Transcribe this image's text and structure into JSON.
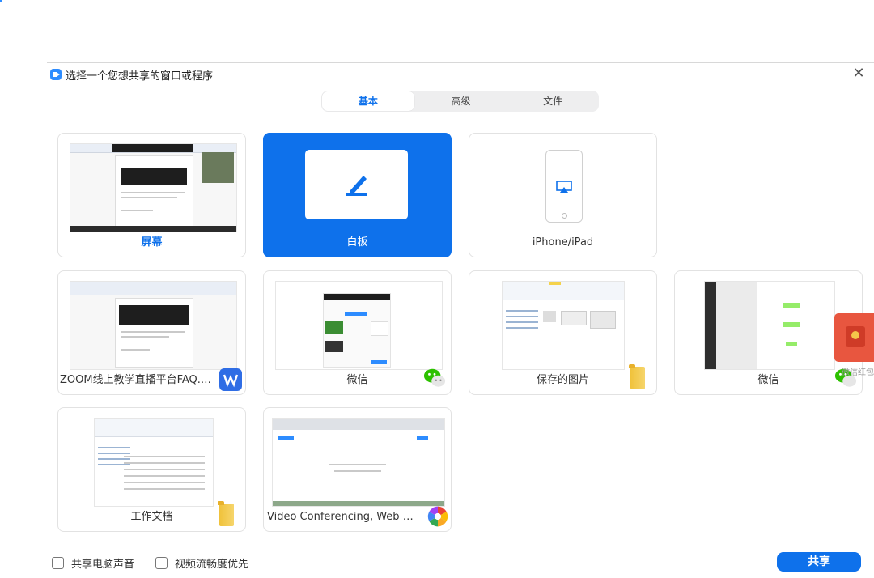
{
  "dialog": {
    "title": "选择一个您想共享的窗口或程序",
    "close_glyph": "✕"
  },
  "tabs": [
    {
      "label": "基本",
      "active": true
    },
    {
      "label": "高级",
      "active": false
    },
    {
      "label": "文件",
      "active": false
    }
  ],
  "tiles": [
    {
      "label": "屏幕",
      "icon": "screen-thumbnail"
    },
    {
      "label": "白板",
      "icon": "pencil-icon",
      "selected": true
    },
    {
      "label": "iPhone/iPad",
      "icon": "airplay-icon"
    },
    {
      "label": "ZOOM线上教学直播平台FAQ.do...",
      "icon": "wps-icon"
    },
    {
      "label": "微信",
      "icon": "wechat-icon"
    },
    {
      "label": "保存的图片",
      "icon": "folder-icon"
    },
    {
      "label": "微信",
      "icon": "wechat-icon"
    },
    {
      "label": "工作文档",
      "icon": "folder-icon"
    },
    {
      "label": "Video Conferencing, Web Confer...",
      "icon": "chrome-icon"
    }
  ],
  "overlay": {
    "red_packet_label": "微信红包"
  },
  "footer": {
    "share_audio": "共享电脑声音",
    "optimize_video": "视频流畅度优先",
    "share_button": "共享"
  },
  "colors": {
    "accent": "#0e71eb",
    "wechat_green": "#2dc100"
  }
}
